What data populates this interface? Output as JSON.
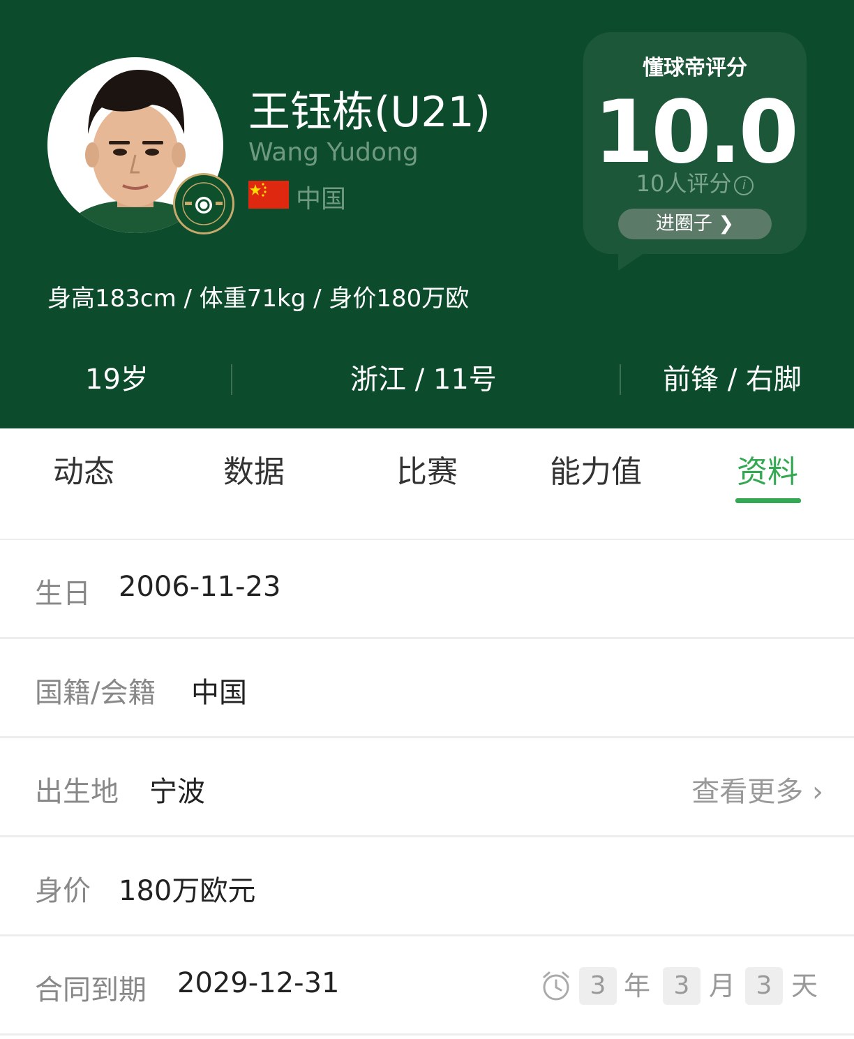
{
  "player": {
    "name_zh": "王钰栋(U21)",
    "name_en": "Wang Yudong",
    "nationality": "中国",
    "body_info": "身高183cm / 体重71kg / 身价180万欧",
    "age": "19岁",
    "club_number": "浙江 / 11号",
    "position_foot": "前锋 / 右脚",
    "club_badge": "zhejiang-football-club-badge"
  },
  "rating": {
    "title": "懂球帝评分",
    "score": "10.0",
    "count_label": "10人评分",
    "info_icon": "i",
    "circle_button": "进圈子 ❯"
  },
  "tabs": [
    {
      "label": "动态"
    },
    {
      "label": "数据"
    },
    {
      "label": "比赛"
    },
    {
      "label": "能力值"
    },
    {
      "label": "资料",
      "active": true
    }
  ],
  "profile": {
    "birthday_label": "生日",
    "birthday": "2006-11-23",
    "nationality_label": "国籍/会籍",
    "nationality": "中国",
    "birthplace_label": "出生地",
    "birthplace": "宁波",
    "more_link": "查看更多 ›",
    "value_label": "身价",
    "value": "180万欧元",
    "contract_label": "合同到期",
    "contract_end": "2029-12-31",
    "countdown": {
      "years": "3",
      "year_unit": "年",
      "months": "3",
      "month_unit": "月",
      "days": "3",
      "day_unit": "天"
    }
  },
  "colors": {
    "header_bg": "#0c4c2c",
    "accent_green": "#34a853",
    "rating_card_bg": "#1d573a"
  }
}
